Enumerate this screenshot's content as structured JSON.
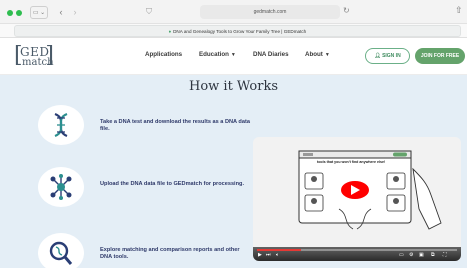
{
  "browser": {
    "url": "gedmatch.com",
    "tab_title": "DNA and Genealogy Tools to Grow Your Family Tree | GEDmatch"
  },
  "header": {
    "logo_line1": "GED",
    "logo_line2": "match",
    "nav": [
      {
        "label": "Applications",
        "has_caret": false
      },
      {
        "label": "Education",
        "has_caret": true
      },
      {
        "label": "DNA Diaries",
        "has_caret": false
      },
      {
        "label": "About",
        "has_caret": true
      }
    ],
    "signin_label": "SIGN IN",
    "join_label": "JOIN FOR FREE"
  },
  "main": {
    "title": "How it Works",
    "steps": [
      {
        "icon": "dna-helix-icon",
        "text": "Take a DNA test and download the results as a DNA data file."
      },
      {
        "icon": "network-nodes-icon",
        "text": "Upload the DNA data file to GEDmatch for processing."
      },
      {
        "icon": "magnify-dna-icon",
        "text": "Explore matching and comparison reports and other DNA tools."
      }
    ],
    "video": {
      "caption": "tools that you won't find anywhere else!",
      "progress": 0.22
    }
  },
  "colors": {
    "accent_green": "#64a36b",
    "panel_bg": "#e4eef6",
    "icon_blue": "#2a3e75",
    "icon_teal": "#2c8f8f",
    "play_red": "#e53935"
  }
}
